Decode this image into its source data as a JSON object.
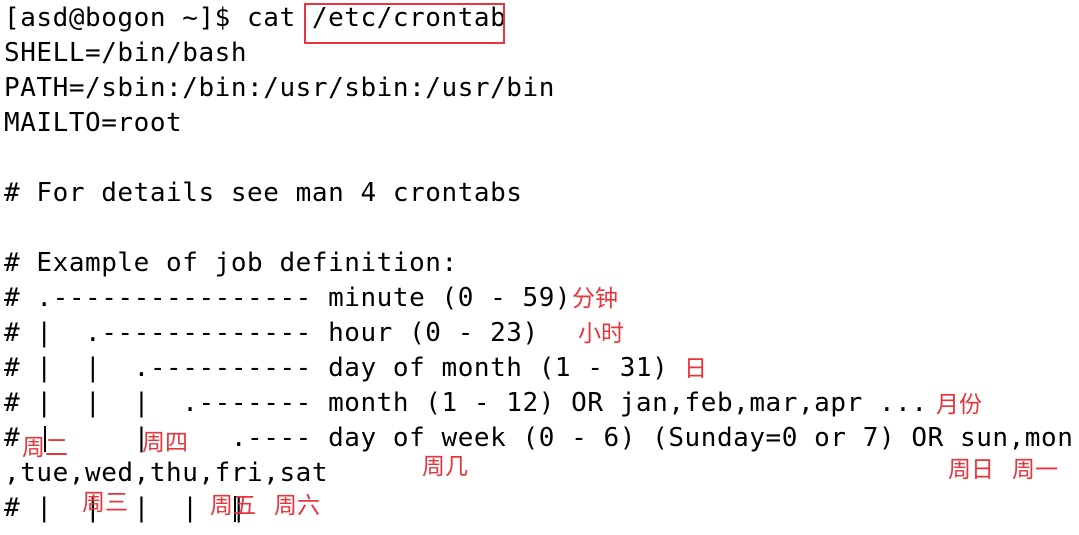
{
  "terminal": {
    "lines": [
      "[asd@bogon ~]$ cat /etc/crontab",
      "SHELL=/bin/bash",
      "PATH=/sbin:/bin:/usr/sbin:/usr/bin",
      "MAILTO=root",
      "",
      "# For details see man 4 crontabs",
      "",
      "# Example of job definition:",
      "# .---------------- minute (0 - 59)",
      "# |  .------------- hour (0 - 23)",
      "# |  |  .---------- day of month (1 - 31)",
      "# |  |  |  .------- month (1 - 12) OR jan,feb,mar,apr ...",
      "#       |     .---- day of week (0 - 6) (Sunday=0 or 7) OR sun,mon",
      ",tue,wed,thu,fri,sat",
      "# |  |  |  |  |"
    ],
    "highlighted_path": "/etc/crontab"
  },
  "annotations": {
    "minute": "分钟",
    "hour": "小时",
    "day": "日",
    "month": "月份",
    "weekday": "周几",
    "tue": "周二",
    "thu": "周四",
    "sun": "周日",
    "mon": "周一",
    "wed": "周三",
    "fri": "周五",
    "sat": "周六"
  },
  "colors": {
    "annotation": "#e8343b",
    "text": "#000000",
    "background": "#ffffff"
  }
}
